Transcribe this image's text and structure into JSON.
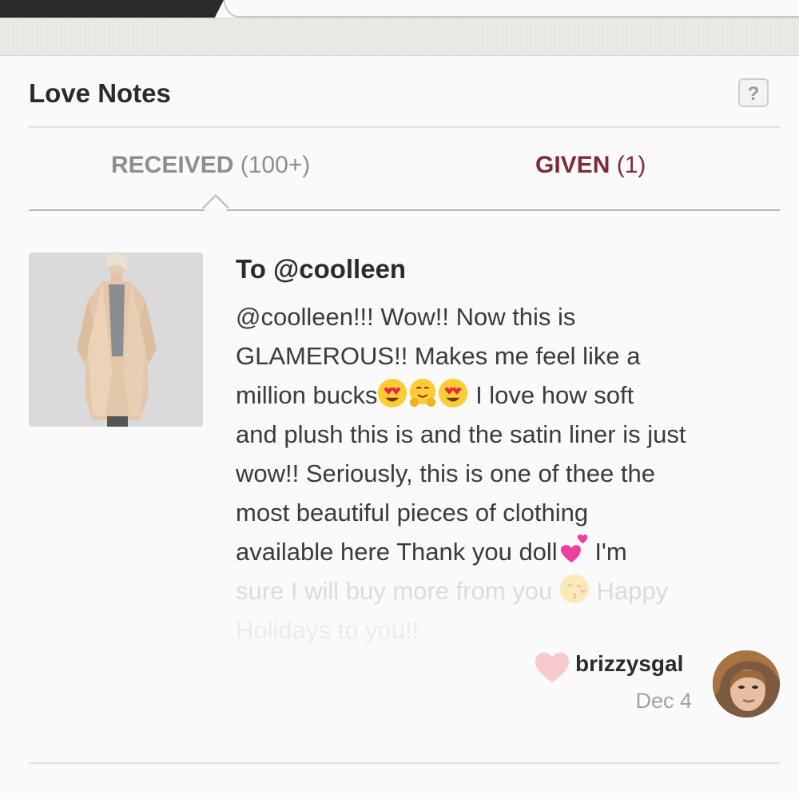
{
  "section_title": "Love Notes",
  "help_label": "?",
  "tabs": [
    {
      "label": "RECEIVED",
      "count": "(100+)",
      "active": true
    },
    {
      "label": "GIVEN",
      "count": "(1)",
      "active": false
    }
  ],
  "note": {
    "to": "To @coolleen",
    "lines": {
      "l1": "@coolleen!!! Wow!! Now this is",
      "l2": "GLAMEROUS!! Makes me feel like a",
      "l3a": "million bucks",
      "l3b": " I love how soft",
      "l4": "and plush this is and the satin liner is just",
      "l5": "wow!! Seriously, this is one of thee the",
      "l6": "most beautiful pieces of clothing",
      "l7a": "available here Thank you doll",
      "l7b": " I'm",
      "l8a": "sure I will buy more from you ",
      "l8b": " Happy",
      "l9": "Holidays to you!!"
    },
    "author": "brizzysgal",
    "date": "Dec 4"
  },
  "icons": {
    "heart": "heart-icon",
    "emoji": [
      "heart-eyes-emoji",
      "hugging-emoji",
      "heart-eyes-emoji",
      "two-hearts-emoji",
      "kissing-face-emoji"
    ]
  },
  "colors": {
    "given_tab": "#7d2a3a",
    "received_tab": "#8f8d8f",
    "heart": "#f7c9cf"
  }
}
